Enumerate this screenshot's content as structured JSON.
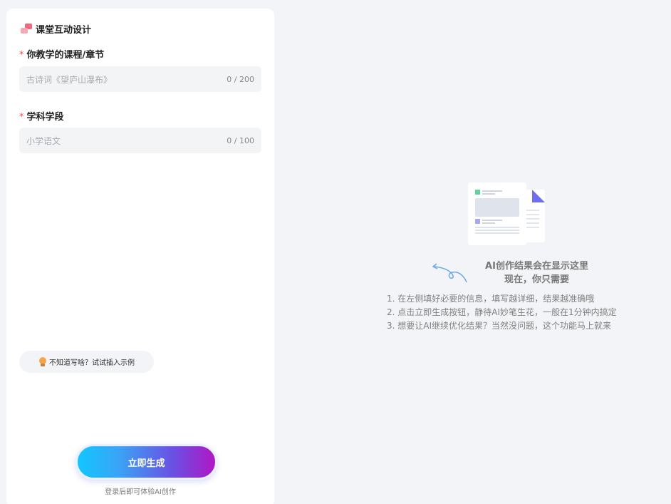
{
  "header": {
    "title": "课堂互动设计",
    "logo_icon": "app-logo-icon"
  },
  "form": {
    "course": {
      "required_mark": "*",
      "label": "你教学的课程/章节",
      "placeholder": "古诗词《望庐山瀑布》",
      "counter": "0 / 200"
    },
    "stage": {
      "required_mark": "*",
      "label": "学科学段",
      "placeholder": "小学语文",
      "counter": "0 / 100"
    }
  },
  "example": {
    "label": "不知道写啥？试试插入示例",
    "icon": "lightbulb-icon"
  },
  "generate": {
    "label": "立即生成",
    "note": "登录后即可体验AI创作"
  },
  "result": {
    "title": "AI创作结果会在显示这里",
    "subtitle": "现在，你只需要",
    "steps": [
      "1. 在左侧填好必要的信息，填写越详细，结果越准确哦",
      "2. 点击立即生成按钮，静待AI妙笔生花，一般在1分钟内搞定",
      "3. 想要让AI继续优化结果？当然没问题，这个功能马上就来"
    ]
  },
  "colors": {
    "accent_start": "#12c6ff",
    "accent_end": "#b117c4",
    "required": "#f24c4c",
    "background": "#f3f4f7"
  }
}
